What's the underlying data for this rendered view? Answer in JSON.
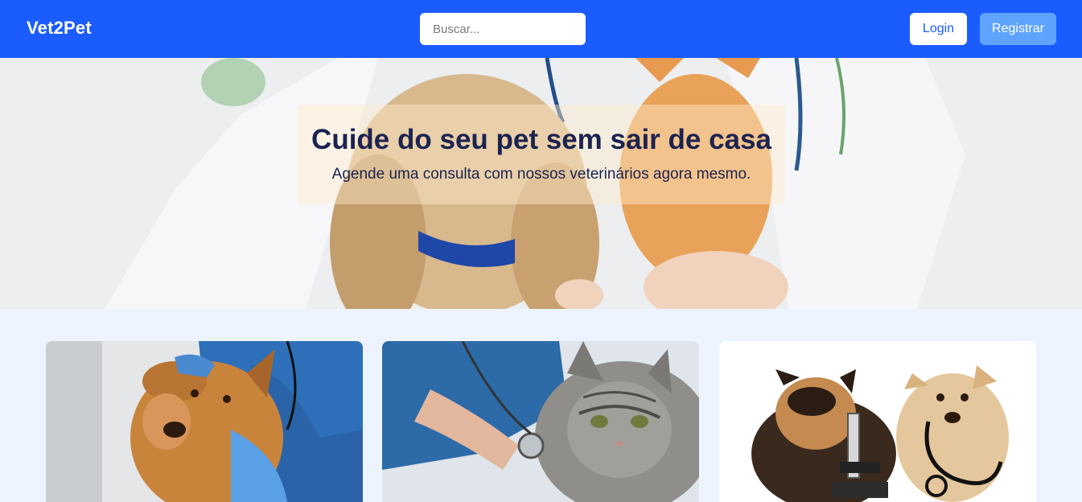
{
  "navbar": {
    "brand": "Vet2Pet",
    "search_placeholder": "Buscar...",
    "login_label": "Login",
    "register_label": "Registrar"
  },
  "hero": {
    "title": "Cuide do seu pet sem sair de casa",
    "subtitle": "Agende uma consulta com nossos veterinários agora mesmo."
  },
  "colors": {
    "navbar": "#1a5cff",
    "register_button": "#5ea4ff",
    "hero_text": "#1b2350",
    "page_background": "#eef4ff"
  },
  "cards": [
    {
      "image": "dog-with-veterinarian-photo"
    },
    {
      "image": "cat-with-stethoscope-photo"
    },
    {
      "image": "puppies-with-microscope-and-stethoscope-photo"
    }
  ]
}
